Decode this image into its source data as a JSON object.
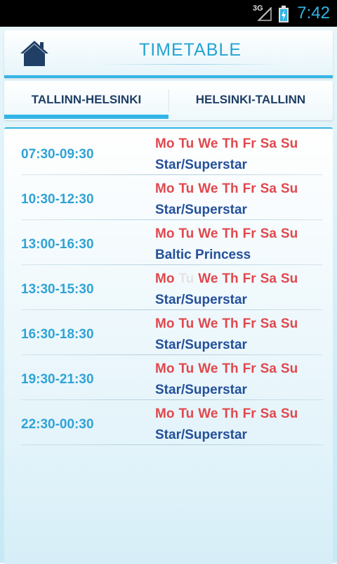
{
  "status_bar": {
    "network": "3G",
    "time": "7:42",
    "signal_icon": "signal-icon",
    "battery_icon": "battery-charging-icon",
    "accent_color": "#33b5e5"
  },
  "header": {
    "title": "TIMETABLE",
    "home_icon": "home-icon"
  },
  "tabs": [
    {
      "label": "TALLINN-HELSINKI",
      "active": true
    },
    {
      "label": "HELSINKI-TALLINN",
      "active": false
    }
  ],
  "colors": {
    "time": "#2fa3d6",
    "day_active": "#e0484e",
    "day_inactive": "#e4e4e4",
    "ship": "#24509a",
    "tab_accent": "#33b5e5"
  },
  "timetable": [
    {
      "time": "07:30-09:30",
      "ship": "Star/Superstar",
      "days": [
        {
          "d": "Mo",
          "on": true
        },
        {
          "d": "Tu",
          "on": true
        },
        {
          "d": "We",
          "on": true
        },
        {
          "d": "Th",
          "on": true
        },
        {
          "d": "Fr",
          "on": true
        },
        {
          "d": "Sa",
          "on": true
        },
        {
          "d": "Su",
          "on": true
        }
      ]
    },
    {
      "time": "10:30-12:30",
      "ship": "Star/Superstar",
      "days": [
        {
          "d": "Mo",
          "on": true
        },
        {
          "d": "Tu",
          "on": true
        },
        {
          "d": "We",
          "on": true
        },
        {
          "d": "Th",
          "on": true
        },
        {
          "d": "Fr",
          "on": true
        },
        {
          "d": "Sa",
          "on": true
        },
        {
          "d": "Su",
          "on": true
        }
      ]
    },
    {
      "time": "13:00-16:30",
      "ship": "Baltic Princess",
      "days": [
        {
          "d": "Mo",
          "on": true
        },
        {
          "d": "Tu",
          "on": true
        },
        {
          "d": "We",
          "on": true
        },
        {
          "d": "Th",
          "on": true
        },
        {
          "d": "Fr",
          "on": true
        },
        {
          "d": "Sa",
          "on": true
        },
        {
          "d": "Su",
          "on": true
        }
      ]
    },
    {
      "time": "13:30-15:30",
      "ship": "Star/Superstar",
      "days": [
        {
          "d": "Mo",
          "on": true
        },
        {
          "d": "Tu",
          "on": false
        },
        {
          "d": "We",
          "on": true
        },
        {
          "d": "Th",
          "on": true
        },
        {
          "d": "Fr",
          "on": true
        },
        {
          "d": "Sa",
          "on": true
        },
        {
          "d": "Su",
          "on": true
        }
      ]
    },
    {
      "time": "16:30-18:30",
      "ship": "Star/Superstar",
      "days": [
        {
          "d": "Mo",
          "on": true
        },
        {
          "d": "Tu",
          "on": true
        },
        {
          "d": "We",
          "on": true
        },
        {
          "d": "Th",
          "on": true
        },
        {
          "d": "Fr",
          "on": true
        },
        {
          "d": "Sa",
          "on": true
        },
        {
          "d": "Su",
          "on": true
        }
      ]
    },
    {
      "time": "19:30-21:30",
      "ship": "Star/Superstar",
      "days": [
        {
          "d": "Mo",
          "on": true
        },
        {
          "d": "Tu",
          "on": true
        },
        {
          "d": "We",
          "on": true
        },
        {
          "d": "Th",
          "on": true
        },
        {
          "d": "Fr",
          "on": true
        },
        {
          "d": "Sa",
          "on": true
        },
        {
          "d": "Su",
          "on": true
        }
      ]
    },
    {
      "time": "22:30-00:30",
      "ship": "Star/Superstar",
      "days": [
        {
          "d": "Mo",
          "on": true
        },
        {
          "d": "Tu",
          "on": true
        },
        {
          "d": "We",
          "on": true
        },
        {
          "d": "Th",
          "on": true
        },
        {
          "d": "Fr",
          "on": true
        },
        {
          "d": "Sa",
          "on": true
        },
        {
          "d": "Su",
          "on": true
        }
      ]
    }
  ]
}
